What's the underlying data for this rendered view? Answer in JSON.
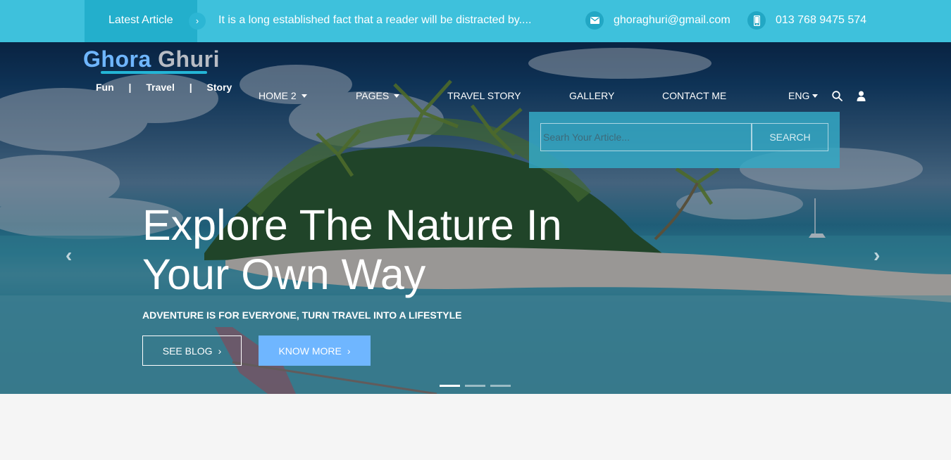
{
  "topbar": {
    "latest_label": "Latest Article",
    "arrow": "›",
    "ticker_text": "It is a long established fact that a reader will be distracted by....",
    "email": "ghoraghuri@gmail.com",
    "phone": "013 768 9475 574",
    "bg_color": "#3ec1dc"
  },
  "brand": {
    "name_part1": "Ghora",
    "name_part2": "Ghuri",
    "tags": [
      "Fun",
      "|",
      "Travel",
      "|",
      "Story"
    ]
  },
  "nav": {
    "items": [
      {
        "label": "HOME 2",
        "dropdown": true
      },
      {
        "label": "PAGES",
        "dropdown": true
      },
      {
        "label": "TRAVEL STORY",
        "dropdown": false
      },
      {
        "label": "GALLERY",
        "dropdown": false
      },
      {
        "label": "CONTACT ME",
        "dropdown": false
      }
    ],
    "language": "ENG",
    "icons": [
      "search-icon",
      "user-icon"
    ]
  },
  "search": {
    "placeholder": "Searh Your Article...",
    "button_label": "SEARCH"
  },
  "hero": {
    "headline": "Explore The Nature In Your Own Way",
    "subheading": "ADVENTURE IS FOR EVERYONE, TURN TRAVEL INTO A LIFESTYLE",
    "see_blog_label": "SEE BLOG",
    "know_more_label": "KNOW MORE",
    "chevron": "›",
    "prev_arrow": "‹",
    "next_arrow": "›",
    "slide_count": 3,
    "active_slide": 1,
    "accent_color": "#6fb6ff"
  }
}
